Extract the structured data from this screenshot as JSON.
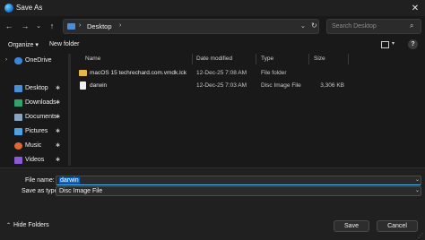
{
  "window": {
    "title": "Save As",
    "close_glyph": "✕"
  },
  "nav": {
    "back": "←",
    "forward": "→",
    "up": "↑",
    "down": "⌄"
  },
  "address": {
    "path": "Desktop",
    "chevron": "›"
  },
  "search": {
    "placeholder": "Search Desktop"
  },
  "toolbar": {
    "organize": "Organize ▾",
    "new_folder": "New folder"
  },
  "sidebar": {
    "items": [
      {
        "label": "OneDrive",
        "icon": "cloud-icon",
        "color": "#3a86d8",
        "expandable": true
      },
      {
        "label": "Desktop",
        "icon": "desktop-icon",
        "color": "#4a8fd6",
        "pinned": true
      },
      {
        "label": "Downloads",
        "icon": "download-icon",
        "color": "#2fa36b",
        "pinned": true
      },
      {
        "label": "Documents",
        "icon": "document-icon",
        "color": "#8aa5c2",
        "pinned": true
      },
      {
        "label": "Pictures",
        "icon": "pictures-icon",
        "color": "#4aa3e6",
        "pinned": true
      },
      {
        "label": "Music",
        "icon": "music-icon",
        "color": "#e0663a",
        "pinned": true
      },
      {
        "label": "Videos",
        "icon": "videos-icon",
        "color": "#8b5bd6",
        "pinned": true
      }
    ],
    "pin_glyph": "📌"
  },
  "list": {
    "columns": [
      "Name",
      "Date modified",
      "Type",
      "Size"
    ],
    "rows": [
      {
        "name": "macOS 15 techrechard.com.vmdk.lck",
        "date": "12-Dec-25 7:08 AM",
        "type": "File folder",
        "size": "",
        "icon": "folder-icon"
      },
      {
        "name": "darwin",
        "date": "12-Dec-25 7:03 AM",
        "type": "Disc Image File",
        "size": "3,306 KB",
        "icon": "disc-image-icon"
      }
    ]
  },
  "form": {
    "file_name_label": "File name:",
    "file_name_value": "darwin",
    "save_as_type_label": "Save as type:",
    "save_as_type_value": "Disc Image File"
  },
  "footer": {
    "hide_folders": "Hide Folders",
    "save": "Save",
    "cancel": "Cancel"
  }
}
